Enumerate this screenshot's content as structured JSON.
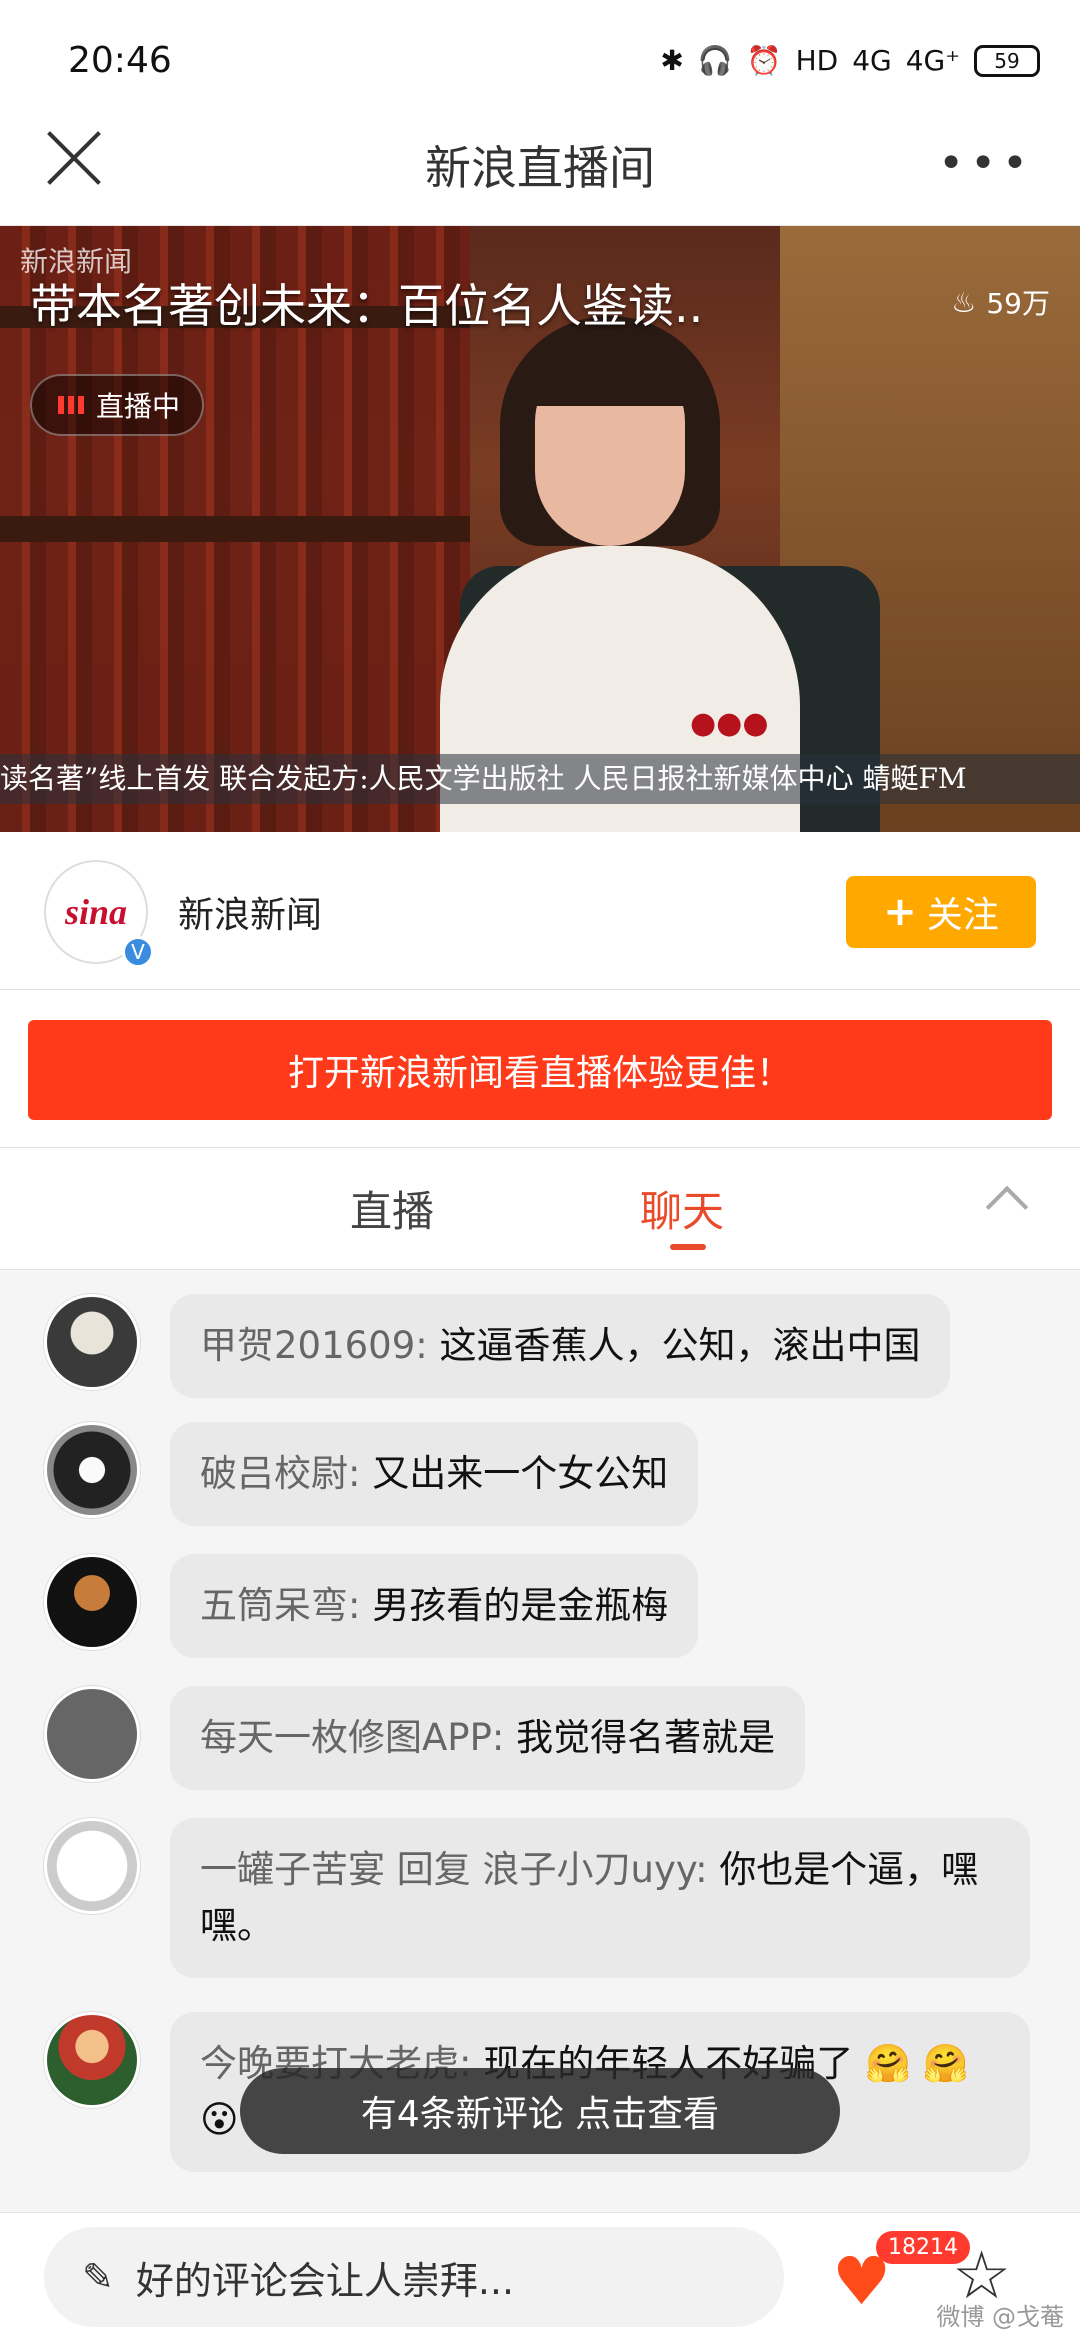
{
  "status_bar": {
    "time": "20:46",
    "bluetooth_glyph": "✱",
    "hd_label": "HD",
    "signal1": "4G",
    "signal2": "4G⁺",
    "battery": "59"
  },
  "navbar": {
    "title": "新浪直播间",
    "more": "•••"
  },
  "video": {
    "title": "带本名著创未来：百位名人鉴读..",
    "watermark": "新浪新闻",
    "views": "59万",
    "live_badge": "直播中",
    "ticker": "读名著”线上首发  联合发起方:人民文学出版社 人民日报社新媒体中心  蜻蜓FM"
  },
  "channel": {
    "avatar_text": "sina",
    "verified_mark": "V",
    "name": "新浪新闻",
    "follow_plus": "+",
    "follow_label": "关注"
  },
  "banner": {
    "text": "打开新浪新闻看直播体验更佳！"
  },
  "tabs": {
    "live": "直播",
    "chat": "聊天"
  },
  "chat": {
    "messages": [
      {
        "user": "甲贺201609:",
        "text": "这逼香蕉人，公知，滚出中国"
      },
      {
        "user": "破吕校尉:",
        "text": "又出来一个女公知"
      },
      {
        "user": "五筒呆弯:",
        "text": "男孩看的是金瓶梅"
      },
      {
        "user": "每天一枚修图APP:",
        "text": "我觉得名著就是"
      },
      {
        "user": "一罐子苦宴  回复 浪子小刀uyy:",
        "text": "你也是个逼，嘿嘿。"
      },
      {
        "user": "今晚要打大老虎:",
        "text": "现在的年轻人不好骗了 🤗 🤗 😮"
      }
    ]
  },
  "toast": "有4条新评论 点击查看",
  "bottom": {
    "input_placeholder": "好的评论会让人崇拜...",
    "pencil": "✎",
    "heart": "♥",
    "like_count": "18214",
    "star": "☆",
    "watermark": "微博 @戈菴"
  }
}
